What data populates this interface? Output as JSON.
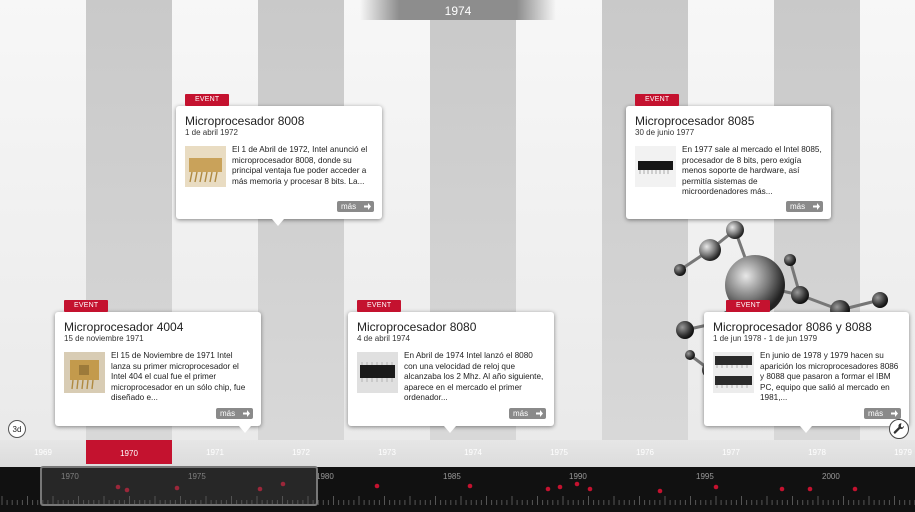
{
  "current_year": "1974",
  "columns": [
    {
      "year": "1969",
      "shade": "light"
    },
    {
      "year": "1970",
      "shade": "dark"
    },
    {
      "year": "1971",
      "shade": "light"
    },
    {
      "year": "1972",
      "shade": "dark"
    },
    {
      "year": "1973",
      "shade": "light"
    },
    {
      "year": "1974",
      "shade": "dark"
    },
    {
      "year": "1975",
      "shade": "light"
    },
    {
      "year": "1976",
      "shade": "dark"
    },
    {
      "year": "1977",
      "shade": "light"
    },
    {
      "year": "1978",
      "shade": "dark"
    },
    {
      "year": "1979",
      "shade": "light"
    }
  ],
  "highlighted_year": "1970",
  "events": [
    {
      "tag": "EVENT",
      "title": "Microprocesador 8008",
      "date": "1 de abril 1972",
      "description": "El 1 de Abril de 1972, Intel anunció el microprocesador 8008, donde su principal ventaja fue poder acceder a más memoria y procesar 8 bits. La...",
      "more": "más",
      "thumb": "chip-gold-icon"
    },
    {
      "tag": "EVENT",
      "title": "Microprocesador 8085",
      "date": "30 de junio 1977",
      "description": "En 1977 sale al mercado el Intel 8085, procesador de 8 bits, pero exigía menos soporte de hardware, así permitía sistemas de microordenadores más...",
      "more": "más",
      "thumb": "chip-black-icon"
    },
    {
      "tag": "EVENT",
      "title": "Microprocesador 4004",
      "date": "15 de noviembre 1971",
      "description": "El 15 de Noviembre de 1971 Intel lanza su primer microprocesador el Intel 404 el cual fue el primer microprocesador en un sólo chip, fue diseñado e...",
      "more": "más",
      "thumb": "chip-gold-icon"
    },
    {
      "tag": "EVENT",
      "title": "Microprocesador 8080",
      "date": "4 de abril 1974",
      "description": "En Abril de 1974 Intel lanzó el 8080 con una velocidad de reloj que alcanzaba los 2 Mhz. Al año siguiente, aparece en el mercado el primer ordenador...",
      "more": "más",
      "thumb": "chip-black-icon"
    },
    {
      "tag": "EVENT",
      "title": "Microprocesador 8086 y 8088",
      "date": "1 de jun 1978 - 1 de jun 1979",
      "description": "En junio de 1978 y 1979 hacen su aparición los microprocesadores 8086 y 8088 que pasaron a formar el IBM PC, equipo que salió al mercado en 1981,...",
      "more": "más",
      "thumb": "chip-pair-icon"
    }
  ],
  "controls": {
    "view_3d": "3d",
    "tools_icon": "wrench-icon"
  },
  "overview": {
    "labels": [
      "1970",
      "1975",
      "1980",
      "1985",
      "1990",
      "1995",
      "2000"
    ]
  },
  "colors": {
    "accent": "#c4122f",
    "dark_column": "#c9c9c9",
    "light_column": "#f3f3f3"
  }
}
